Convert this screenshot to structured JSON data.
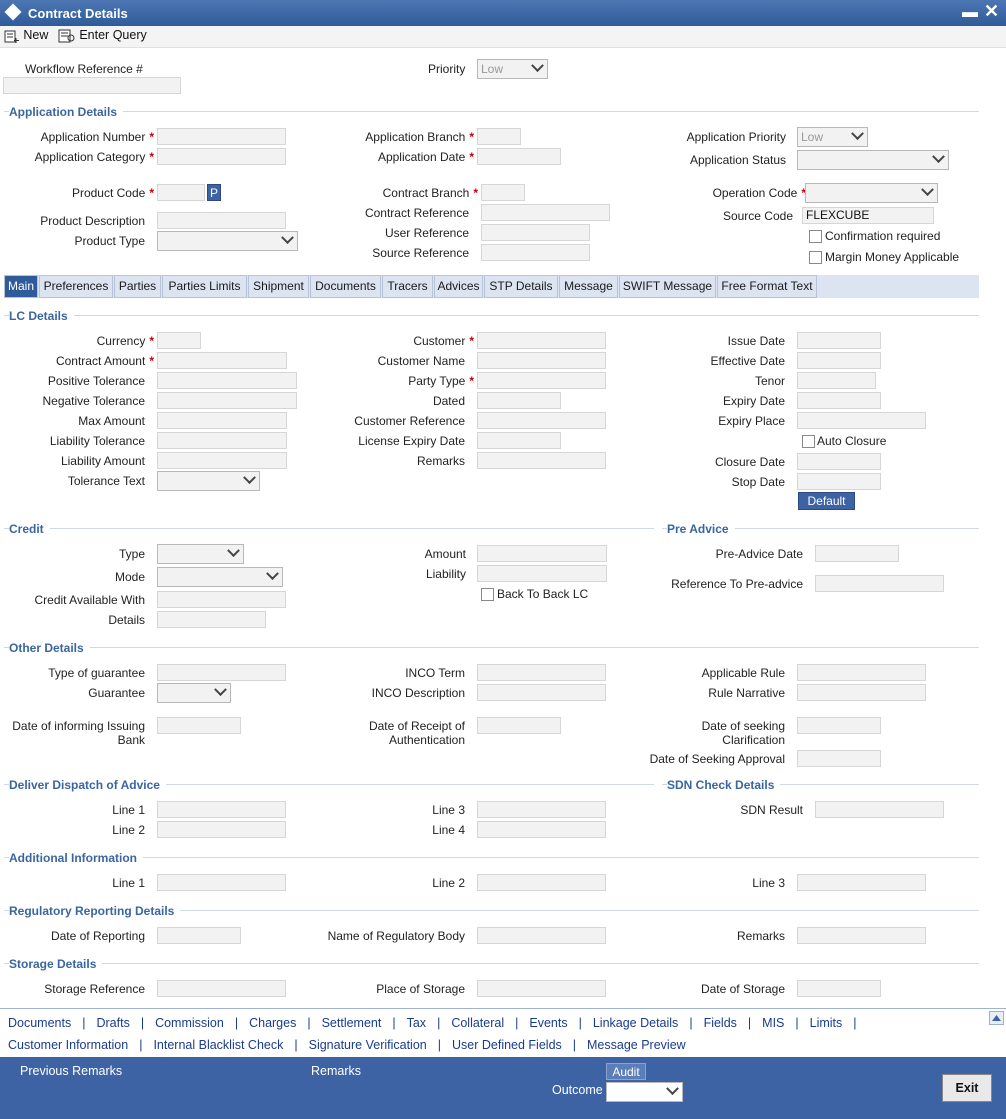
{
  "window": {
    "title": "Contract Details"
  },
  "toolbar": {
    "new_label": "New",
    "enter_query_label": "Enter Query"
  },
  "header": {
    "workflow_ref_label": "Workflow Reference #",
    "priority_label": "Priority",
    "priority_value": "Low"
  },
  "app": {
    "section_title": "Application Details",
    "number_label": "Application Number",
    "category_label": "Application Category",
    "branch_label": "Application Branch",
    "date_label": "Application Date",
    "priority_label": "Application Priority",
    "priority_value": "Low",
    "status_label": "Application Status",
    "product_code_label": "Product Code",
    "product_code_btn": "P",
    "product_desc_label": "Product Description",
    "product_type_label": "Product Type",
    "contract_branch_label": "Contract Branch",
    "contract_ref_label": "Contract Reference",
    "user_ref_label": "User Reference",
    "source_ref_label": "Source Reference",
    "operation_code_label": "Operation Code",
    "source_code_label": "Source Code",
    "source_code_value": "FLEXCUBE",
    "confirmation_label": "Confirmation required",
    "margin_label": "Margin Money Applicable"
  },
  "tabs": [
    "Main",
    "Preferences",
    "Parties",
    "Parties Limits",
    "Shipment",
    "Documents",
    "Tracers",
    "Advices",
    "STP Details",
    "Message",
    "SWIFT Message",
    "Free Format Text"
  ],
  "lc": {
    "section_title": "LC Details",
    "currency": "Currency",
    "contract_amount": "Contract Amount",
    "positive_tol": "Positive Tolerance",
    "negative_tol": "Negative Tolerance",
    "max_amount": "Max Amount",
    "liability_tol": "Liability Tolerance",
    "liability_amount": "Liability Amount",
    "tolerance_text": "Tolerance Text",
    "customer": "Customer",
    "customer_name": "Customer Name",
    "party_type": "Party Type",
    "dated": "Dated",
    "customer_ref": "Customer Reference",
    "license_expiry": "License Expiry Date",
    "remarks": "Remarks",
    "issue_date": "Issue Date",
    "effective_date": "Effective Date",
    "tenor": "Tenor",
    "expiry_date": "Expiry Date",
    "expiry_place": "Expiry Place",
    "auto_closure": "Auto Closure",
    "closure_date": "Closure Date",
    "stop_date": "Stop Date",
    "default_btn": "Default"
  },
  "credit": {
    "section_title": "Credit",
    "type": "Type",
    "mode": "Mode",
    "available_with": "Credit Available With",
    "details": "Details",
    "amount": "Amount",
    "liability": "Liability",
    "back_to_back": "Back To Back LC"
  },
  "pre_advice": {
    "section_title": "Pre Advice",
    "date": "Pre-Advice Date",
    "reference": "Reference To Pre-advice"
  },
  "other": {
    "section_title": "Other Details",
    "type_of_guarantee": "Type of guarantee",
    "guarantee": "Guarantee",
    "date_informing": "Date of informing Issuing Bank",
    "inco_term": "INCO Term",
    "inco_desc": "INCO Description",
    "date_receipt": "Date of Receipt of Authentication",
    "applicable_rule": "Applicable Rule",
    "rule_narrative": "Rule Narrative",
    "date_seeking_clar": "Date of seeking Clarification",
    "date_seeking_appr": "Date of Seeking Approval"
  },
  "dispatch": {
    "section_title": "Deliver Dispatch of Advice",
    "line1": "Line 1",
    "line2": "Line 2",
    "line3": "Line 3",
    "line4": "Line 4"
  },
  "sdn": {
    "section_title": "SDN Check Details",
    "result": "SDN Result"
  },
  "additional": {
    "section_title": "Additional Information",
    "line1": "Line 1",
    "line2": "Line 2",
    "line3": "Line 3"
  },
  "regulatory": {
    "section_title": "Regulatory Reporting Details",
    "date": "Date of Reporting",
    "body": "Name of Regulatory Body",
    "remarks": "Remarks"
  },
  "storage": {
    "section_title": "Storage Details",
    "reference": "Storage Reference",
    "place": "Place of Storage",
    "date": "Date of Storage"
  },
  "links_row1": [
    "Documents",
    "Drafts",
    "Commission",
    "Charges",
    "Settlement",
    "Tax",
    "Collateral",
    "Events",
    "Linkage Details",
    "Fields",
    "MIS",
    "Limits"
  ],
  "links_row2": [
    "Customer Information",
    "Internal Blacklist Check",
    "Signature Verification",
    "User Defined Fields",
    "Message Preview"
  ],
  "footer": {
    "prev_remarks": "Previous Remarks",
    "remarks": "Remarks",
    "audit": "Audit",
    "outcome": "Outcome",
    "exit": "Exit"
  }
}
